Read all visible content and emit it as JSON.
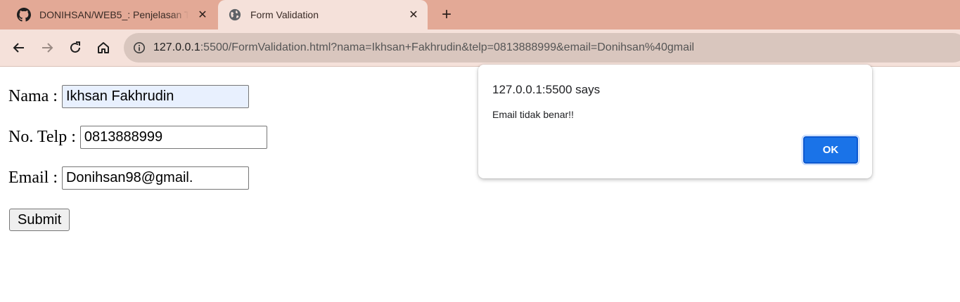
{
  "browser": {
    "tabs": [
      {
        "title": "DONIHSAN/WEB5_: Penjelasan T",
        "favicon": "github-icon",
        "active": false
      },
      {
        "title": "Form Validation",
        "favicon": "globe-icon",
        "active": true
      }
    ],
    "newtab_label": "+",
    "address": {
      "host": "127.0.0.1",
      "rest": ":5500/FormValidation.html?nama=Ikhsan+Fakhrudin&telp=0813888999&email=Donihsan%40gmail"
    }
  },
  "form": {
    "nama_label": "Nama :",
    "nama_value": "Ikhsan Fakhrudin",
    "telp_label": "No. Telp :",
    "telp_value": "0813888999",
    "email_label": "Email :",
    "email_value": "Donihsan98@gmail.",
    "submit_label": "Submit"
  },
  "dialog": {
    "title": "127.0.0.1:5500 says",
    "message": "Email tidak benar!!",
    "ok_label": "OK"
  },
  "colors": {
    "tabstrip": "#e3a996",
    "toolbar": "#f5e1da",
    "accent": "#1a73e8"
  }
}
